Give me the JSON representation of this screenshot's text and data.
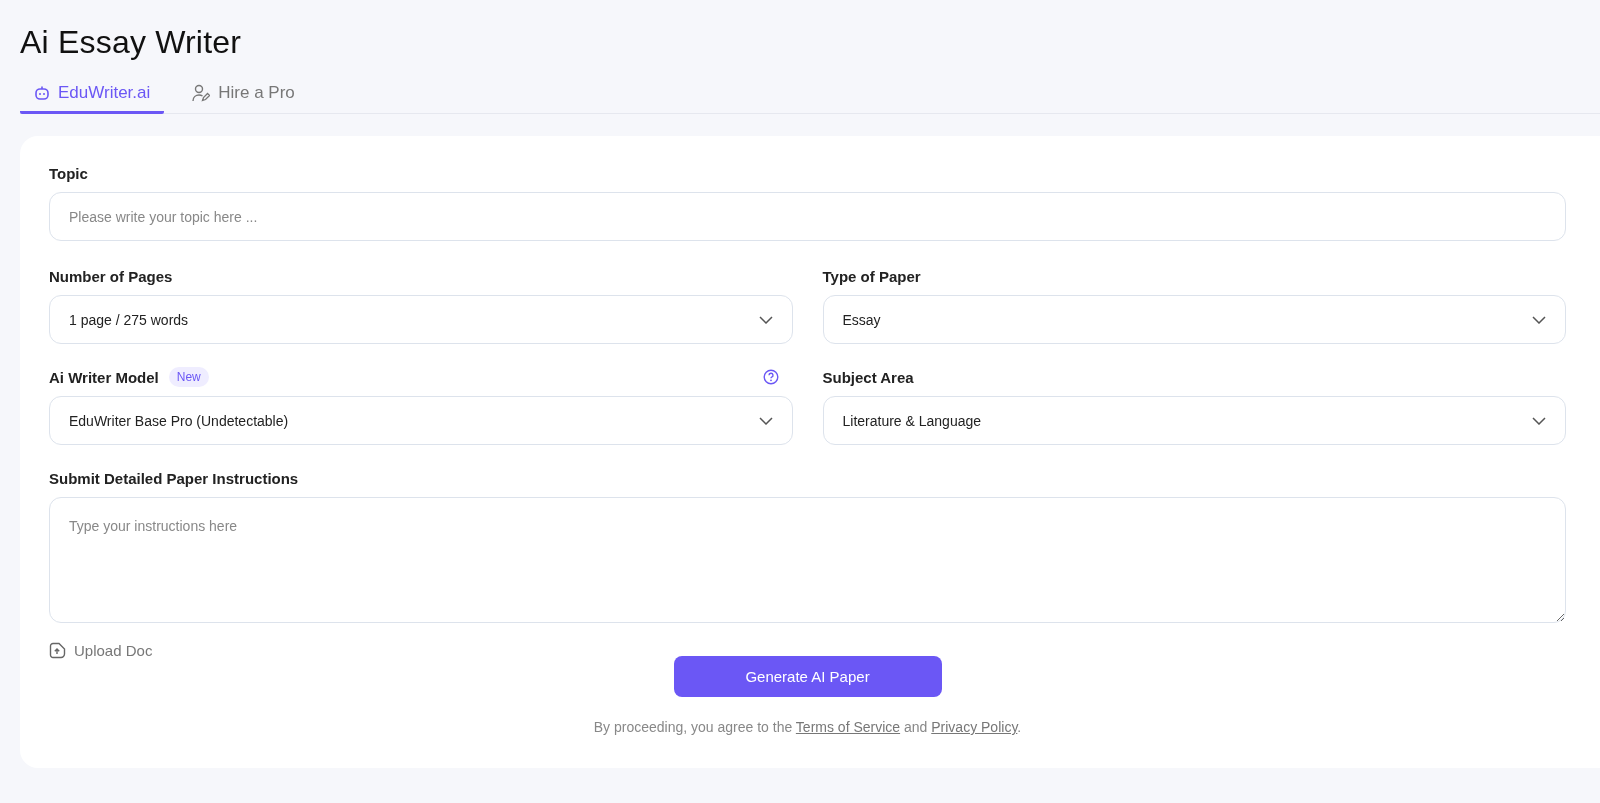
{
  "page": {
    "title": "Ai Essay Writer"
  },
  "tabs": [
    {
      "label": "EduWriter.ai",
      "selected": true,
      "kind": "robot"
    },
    {
      "label": "Hire a Pro",
      "selected": false,
      "kind": "person"
    }
  ],
  "form": {
    "topic": {
      "label": "Topic",
      "placeholder": "Please write your topic here ..."
    },
    "fields": [
      {
        "label": "Number of Pages",
        "value": "1 page / 275 words"
      },
      {
        "label": "Type of Paper",
        "value": "Essay"
      },
      {
        "label": "Ai Writer Model",
        "badge": "New",
        "help": true,
        "value": "EduWriter Base Pro (Undetectable)"
      },
      {
        "label": "Subject Area",
        "value": "Literature & Language"
      }
    ],
    "instructions": {
      "label": "Submit Detailed Paper Instructions",
      "placeholder": "Type your instructions here"
    },
    "upload": "Upload Doc",
    "submit": "Generate AI Paper",
    "consent": {
      "before": "By proceeding, you agree to the ",
      "terms": "Terms of Service",
      "middle": " and ",
      "privacy": "Privacy Policy",
      "after": "."
    }
  }
}
